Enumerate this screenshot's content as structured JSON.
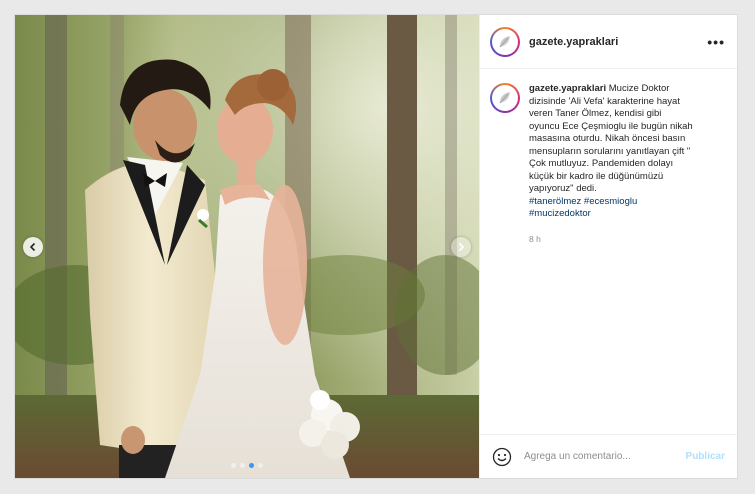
{
  "post": {
    "username": "gazete.yapraklari",
    "more_icon": "more-horizontal-icon",
    "caption": {
      "username": "gazete.yapraklari",
      "lines": [
        "Mucize Doktor",
        "dizisinde 'Ali Vefa' karakterine hayat",
        "veren Taner Ölmez, kendisi gibi",
        "oyuncu Ece Çeşmioglu ile bugün nikah",
        "masasına oturdu. Nikah öncesi basın",
        "mensupların sorularını yanıtlayan çift \"",
        "Çok mutluyuz. Pandemiden dolayı",
        "küçük bir kadro ile düğünümüzü",
        "yapıyoruz\" dedi."
      ],
      "hashtags": [
        "#tanerölmez",
        "#ecesmioglu",
        "#mucizedoktor"
      ]
    },
    "time": "8 h",
    "comment": {
      "placeholder": "Agrega un comentario...",
      "value": "",
      "publish_label": "Publicar"
    },
    "carousel": {
      "slide_count": 4,
      "active_slide": 2
    }
  },
  "colors": {
    "link": "#00376b",
    "publish_disabled": "#b2dffc",
    "active_dot": "#3897f0",
    "border": "#dbdbdb"
  }
}
